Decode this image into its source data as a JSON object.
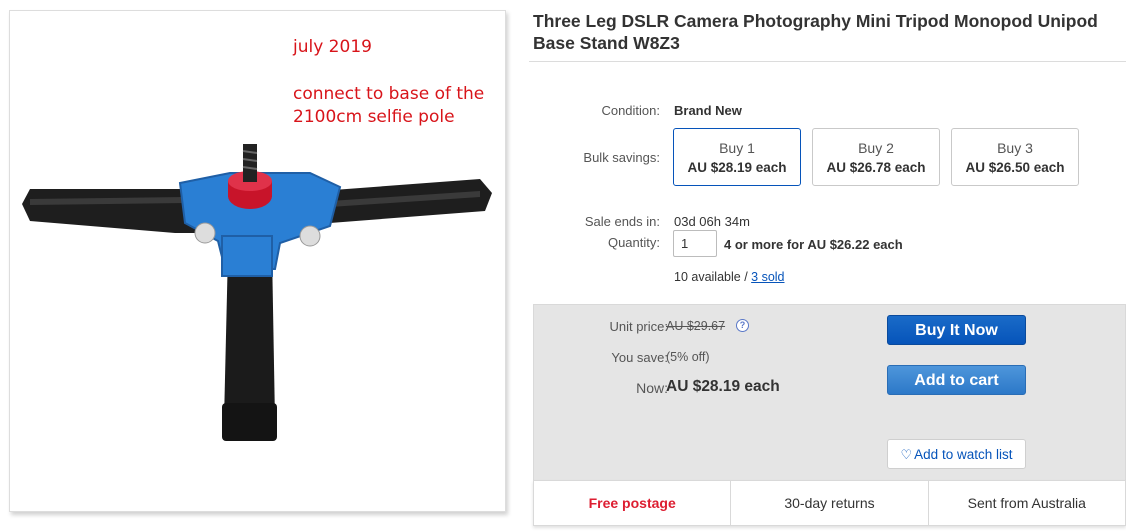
{
  "image_panel": {
    "note_date": "july 2019",
    "note_desc": "connect to base of the 2100cm selfie pole"
  },
  "listing": {
    "title": "Three Leg DSLR Camera Photography Mini Tripod Monopod Unipod Base Stand W8Z3"
  },
  "details": {
    "condition_label": "Condition:",
    "condition_value": "Brand New",
    "bulk_label": "Bulk savings:",
    "bulk_options": [
      {
        "top": "Buy 1",
        "price": "AU $28.19 each",
        "selected": true
      },
      {
        "top": "Buy 2",
        "price": "AU $26.78 each",
        "selected": false
      },
      {
        "top": "Buy 3",
        "price": "AU $26.50 each",
        "selected": false
      }
    ],
    "sale_label": "Sale ends in:",
    "sale_value": "03d 06h 34m",
    "quantity_label": "Quantity:",
    "quantity_value": "1",
    "quantity_offer": "4 or more for AU $26.22 each",
    "available_text": "10 available / ",
    "sold_link": "3 sold"
  },
  "pricing": {
    "unit_label": "Unit price:",
    "unit_original": "AU $29.67",
    "help_glyph": "?",
    "save_label": "You save:",
    "save_value": "(5% off)",
    "now_label": "Now:",
    "now_value": "AU $28.19 each",
    "buy_now": "Buy It Now",
    "add_to_cart": "Add to cart",
    "watch": "Add to watch list",
    "heart_glyph": "♡"
  },
  "shipping": {
    "items": [
      "Free postage",
      "30-day returns",
      "Sent from Australia"
    ]
  },
  "colors": {
    "brand_blue": "#0654ba",
    "note_red": "#d8141a",
    "free_red": "#dd1e31",
    "tripod_blue": "#2a7fd4",
    "knob_red": "#c8142a"
  }
}
